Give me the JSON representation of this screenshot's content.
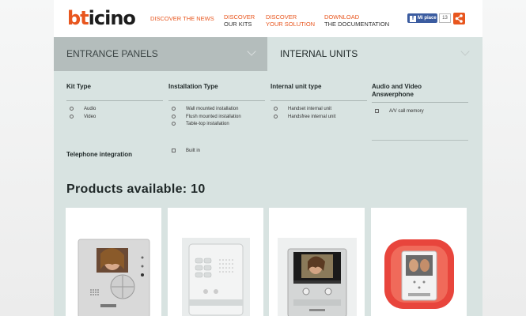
{
  "header": {
    "logo": {
      "prefix": "bt",
      "rest": "icino"
    },
    "nav": [
      {
        "line1": "DISCOVER THE NEWS",
        "line2": ""
      },
      {
        "line1": "DISCOVER",
        "line2": "OUR KITS"
      },
      {
        "line1": "DISCOVER",
        "line2": "YOUR SOLUTION"
      },
      {
        "line1": "DOWNLOAD",
        "line2": "THE DOCUMENTATION"
      }
    ],
    "facebook": {
      "label": "Mi piace",
      "count": "13"
    }
  },
  "tabs": [
    {
      "label": "ENTRANCE PANELS"
    },
    {
      "label": "INTERNAL UNITS"
    }
  ],
  "filters": {
    "kit_type": {
      "title": "Kit Type",
      "options": [
        "Audio",
        "Video"
      ]
    },
    "installation_type": {
      "title": "Installation Type",
      "options": [
        "Wall mounted installation",
        "Flush mounted installation",
        "Table-top installation"
      ]
    },
    "internal_unit_type": {
      "title": "Internal unit type",
      "options": [
        "Handset internal unit",
        "Handsfree internal unit"
      ]
    },
    "audio_video": {
      "title_line1": "Audio and Video",
      "title_line2": "Answerphone",
      "options": [
        "A/V call memory"
      ]
    },
    "telephone": {
      "title": "Telephone integration",
      "options": [
        "Built in"
      ]
    }
  },
  "products": {
    "title": "Products available: 10"
  },
  "colors": {
    "accent": "#e8561e",
    "panel": "#d8e3e1",
    "tab_inactive": "#b4bdbc"
  }
}
